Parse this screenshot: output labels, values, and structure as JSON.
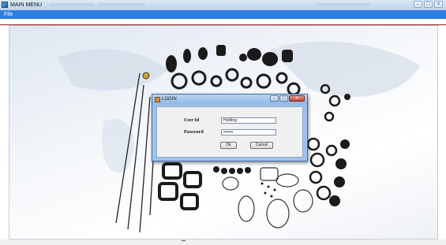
{
  "window": {
    "title": "MAIN MENU",
    "controls": [
      "minimize",
      "maximize",
      "close"
    ]
  },
  "menu": {
    "items": [
      "File"
    ]
  },
  "login": {
    "title": "LOGIN",
    "user_id_label": "User Id",
    "user_id_value": "Holding",
    "password_label": "Password",
    "password_value": "•••••••",
    "ok_label": "Ok",
    "cancel_label": "Cancel"
  },
  "colors": {
    "menu_bar": "#2f7fe0",
    "dialog_frame": "#9ec2ea",
    "accent_line": "#8d1a1a"
  }
}
